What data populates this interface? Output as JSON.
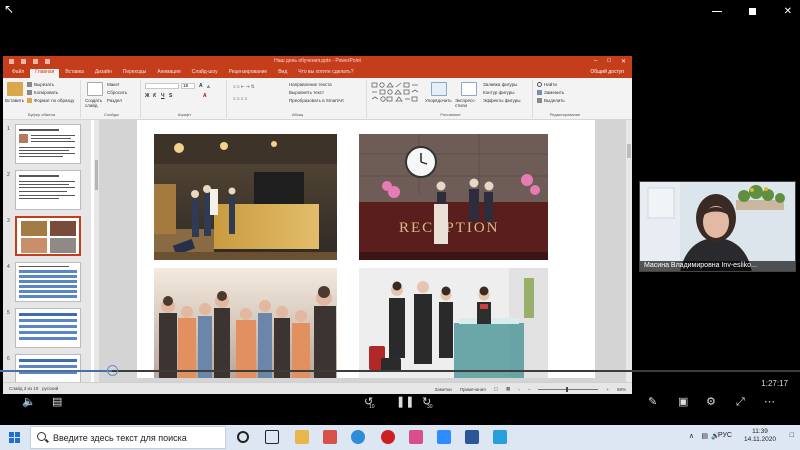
{
  "app": {
    "window_title": "Наш день обучения.pptx - PowerPoint",
    "share_label": "Общий доступ",
    "tabs": [
      "Файл",
      "Главная",
      "Вставка",
      "Дизайн",
      "Переходы",
      "Анимация",
      "Слайд-шоу",
      "Рецензирование",
      "Вид",
      "Что вы хотите сделать?"
    ],
    "active_tab": "Главная"
  },
  "ribbon": {
    "clipboard": {
      "paste": "Вставить",
      "cut": "Вырезать",
      "copy": "Копировать",
      "format_painter": "Формат по образцу",
      "label": "Буфер обмена"
    },
    "slides": {
      "new_slide": "Создать слайд",
      "layout": "Макет",
      "reset": "Сбросить",
      "section": "Раздел",
      "label": "Слайды"
    },
    "font": {
      "font_size": "18",
      "label": "Шрифт"
    },
    "paragraph": {
      "text_direction": "Направление текста",
      "align_text": "Выровнять текст",
      "smartart": "Преобразовать в SmartArt",
      "label": "Абзац"
    },
    "drawing": {
      "arrange": "Упорядочить",
      "quick_styles": "Экспресс-стили",
      "fill": "Заливка фигуры",
      "outline": "Контур фигуры",
      "effects": "Эффекты фигуры",
      "label": "Рисование"
    },
    "editing": {
      "find": "Найти",
      "replace": "Заменить",
      "select": "Выделить",
      "label": "Редактирование"
    }
  },
  "thumbnails": [
    {
      "num": "1",
      "selected": false
    },
    {
      "num": "2",
      "selected": false
    },
    {
      "num": "3",
      "selected": true
    },
    {
      "num": "4",
      "selected": false
    },
    {
      "num": "5",
      "selected": false
    },
    {
      "num": "6",
      "selected": false
    }
  ],
  "statusbar": {
    "slide_info": "Слайд 3 из 19",
    "language": "русский",
    "notes": "Заметки",
    "comments": "Примечания",
    "zoom": "68%"
  },
  "player": {
    "time": "1:27:17",
    "progress_fraction": 0.14,
    "rewind_label": "10",
    "forward_label": "30"
  },
  "video": {
    "name": "Масина Владимировна Inv-esliko..."
  },
  "taskbar": {
    "search_placeholder": "Введите здесь текст для поиска",
    "language": "РУС",
    "time": "11:39",
    "date": "14.11.2020"
  },
  "colors": {
    "ppt_accent": "#c43e1c",
    "taskbar_bg": "#dde7f3",
    "progress_fill": "#4a6fa5"
  }
}
